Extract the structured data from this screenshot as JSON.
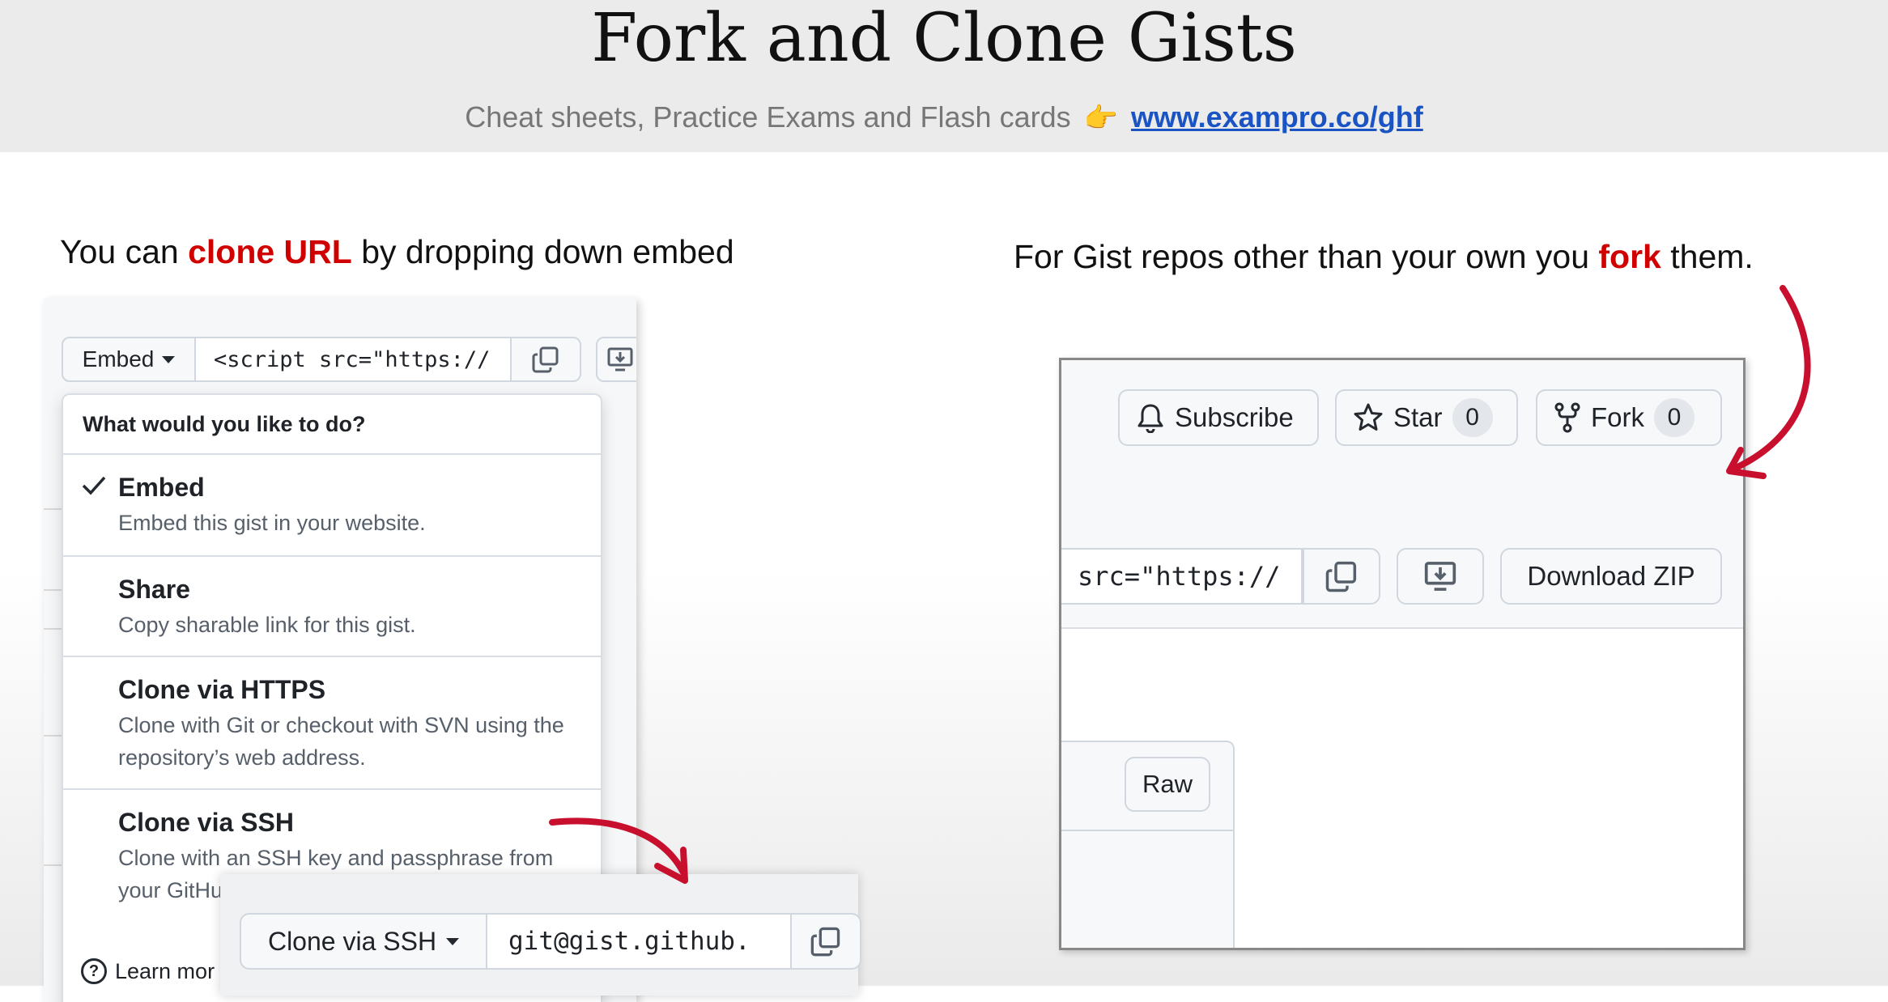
{
  "header": {
    "title": "Fork and Clone Gists",
    "subtitle": "Cheat sheets, Practice Exams and Flash cards",
    "pointer_emoji": "👉",
    "link": "www.exampro.co/ghf"
  },
  "left_caption": {
    "pre": "You can ",
    "highlight": "clone URL",
    "post": " by dropping down embed"
  },
  "right_caption": {
    "pre": "For Gist repos other than your own you ",
    "highlight": "fork",
    "post": " them."
  },
  "embed_panel": {
    "embed_button": "Embed",
    "embed_input_value": "<script src=\"https://",
    "dropdown": {
      "header": "What would you like to do?",
      "items": [
        {
          "title": "Embed",
          "desc": "Embed this gist in your website.",
          "checked": true
        },
        {
          "title": "Share",
          "desc": "Copy sharable link for this gist."
        },
        {
          "title": "Clone via HTTPS",
          "desc": "Clone with Git or checkout with SVN using the repository’s web address."
        },
        {
          "title": "Clone via SSH",
          "desc": "Clone with an SSH key and passphrase from your GitHu"
        }
      ],
      "footer": "Learn mor"
    }
  },
  "ssh_panel": {
    "button": "Clone via SSH",
    "input_value": "git@gist.github."
  },
  "gist_toolbar": {
    "subscribe": "Subscribe",
    "star": "Star",
    "star_count": "0",
    "fork": "Fork",
    "fork_count": "0",
    "embed_input_value": "src=\"https://",
    "download_zip": "Download ZIP",
    "raw": "Raw"
  },
  "colors": {
    "accent_red": "#d00000",
    "link_blue": "#1a54c4"
  }
}
